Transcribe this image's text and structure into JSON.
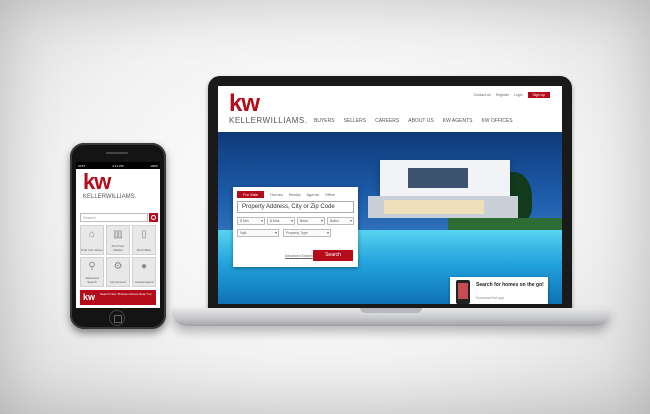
{
  "laptop": {
    "site": {
      "logo": "kw",
      "brand_name": "KELLERWILLIAMS.",
      "top_links": [
        "Contact Us",
        "Register",
        "Login"
      ],
      "top_cta": "Sign Up",
      "nav": [
        "BUYERS",
        "SELLERS",
        "CAREERS",
        "ABOUT US",
        "KW AGENTS",
        "KW OFFICES"
      ]
    },
    "search": {
      "tabs": [
        "For Sale",
        "Homes",
        "Rental",
        "Agents",
        "Office"
      ],
      "placeholder": "Property Address, City or Zip Code",
      "min_price": "$ Min",
      "max_price": "$ Max",
      "beds": "Beds",
      "baths": "Baths",
      "sqft": "Sqft",
      "property_type": "Property Type",
      "advanced_link": "Advanced Search",
      "submit": "Search"
    },
    "promo": {
      "title": "Search for homes on the go!",
      "subtitle": "Download the app"
    }
  },
  "phone": {
    "status": {
      "carrier": "AT&T",
      "time": "4:12 PM",
      "battery": "100%"
    },
    "logo": "kw",
    "brand_name": "KELLERWILLIAMS.",
    "search_placeholder": "Search",
    "tiles": [
      {
        "icon": "home-icon",
        "glyph": "⌂",
        "label": "Find Your Home"
      },
      {
        "icon": "buildings-icon",
        "glyph": "▥",
        "label": "Find Your Market"
      },
      {
        "icon": "office-icon",
        "glyph": "▯",
        "label": "Find Office"
      },
      {
        "icon": "magnifier-icon",
        "glyph": "⚲",
        "label": "Advanced Search"
      },
      {
        "icon": "gears-icon",
        "glyph": "⚙",
        "label": "My Account"
      },
      {
        "icon": "chat-icon",
        "glyph": "●",
        "label": "Contact Agent"
      }
    ],
    "banner": {
      "logo": "kw",
      "text": "Search Now. Browse Homes Near You"
    }
  },
  "colors": {
    "brand_red": "#b40c1a"
  }
}
